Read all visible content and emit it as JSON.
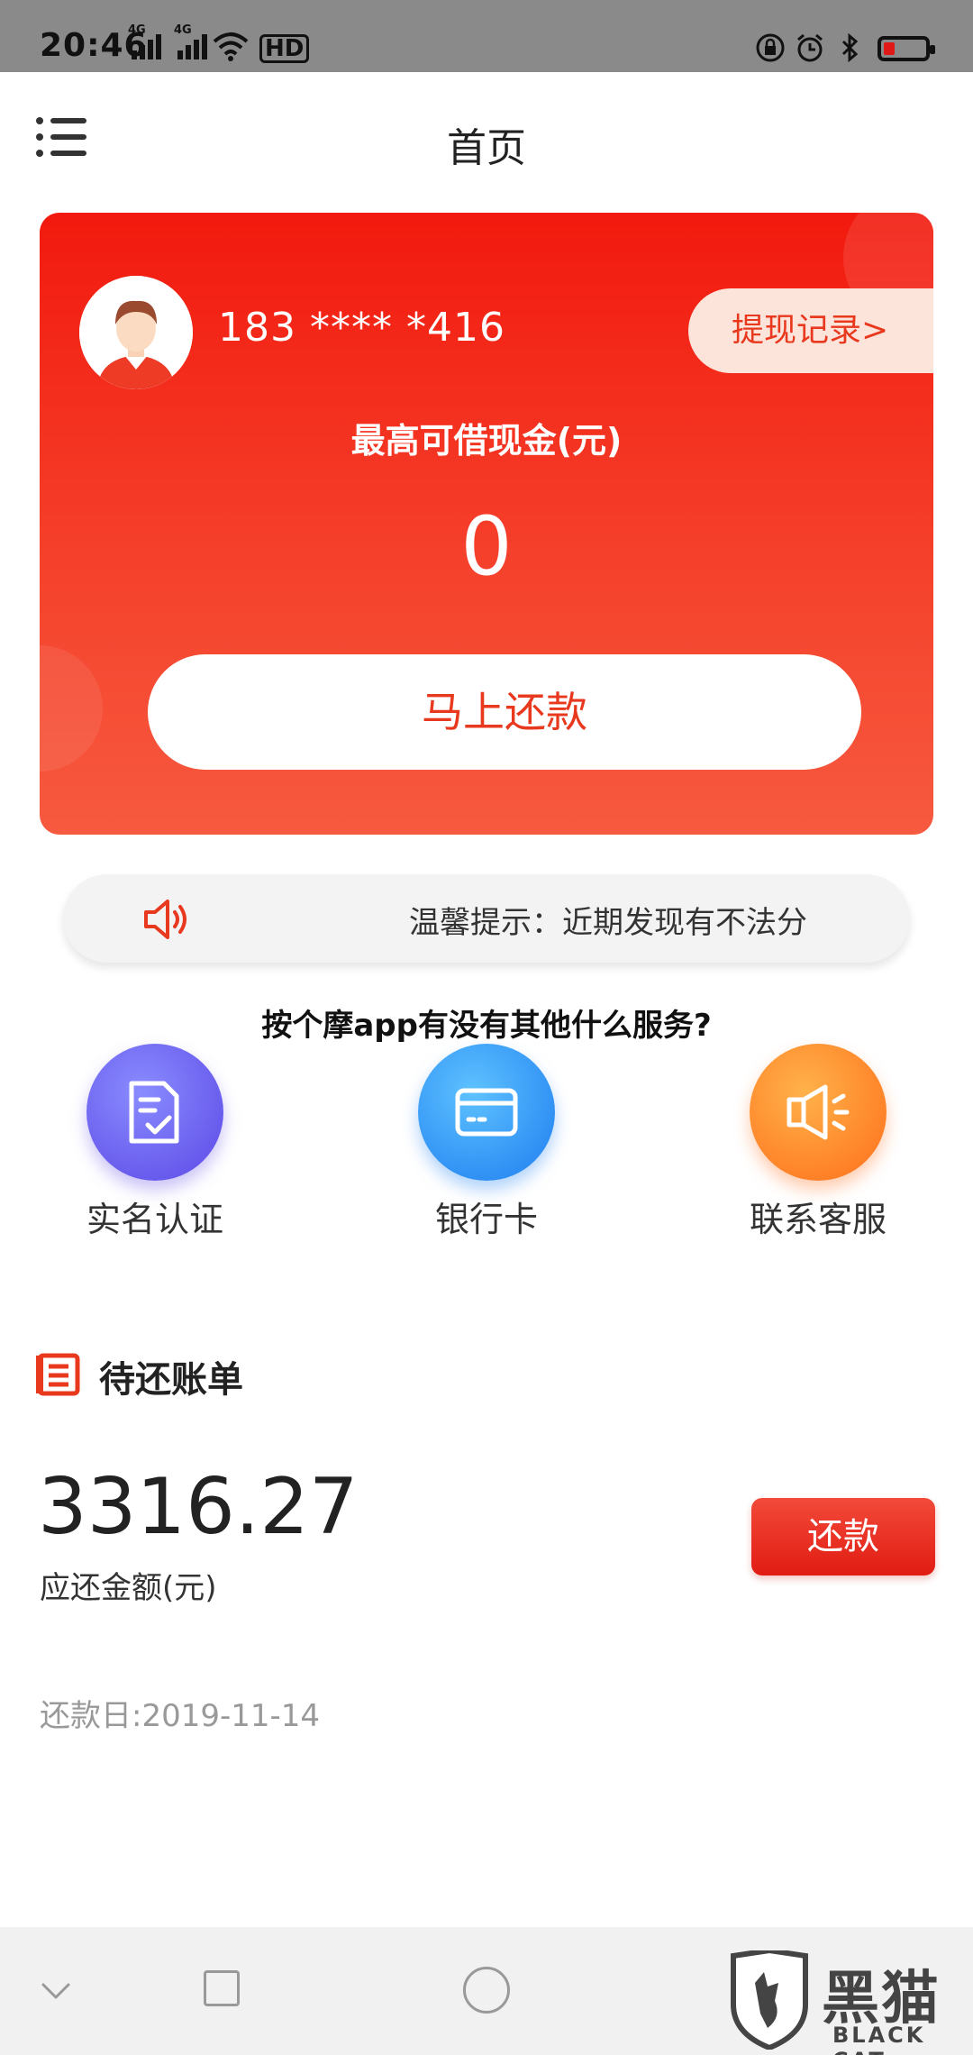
{
  "status_bar": {
    "time": "20:46",
    "network_1": "4G",
    "network_2": "4G",
    "hd_label": "HD",
    "battery_color": "#e01818"
  },
  "header": {
    "title": "首页",
    "menu_icon": "menu-icon"
  },
  "account_card": {
    "phone": "183 **** *416",
    "withdraw_records_label": "提现记录>",
    "max_loan_label": "最高可借现金(元)",
    "max_loan_value": "0",
    "repay_now_label": "马上还款",
    "accent_color": "#f2190d"
  },
  "notice": {
    "icon": "speaker-icon",
    "text": "温馨提示：近期发现有不法分"
  },
  "overlay_question": "按个摩app有没有其他什么服务?",
  "quick_actions": [
    {
      "label": "实名认证",
      "icon": "document-check-icon",
      "color": "#5b48e6"
    },
    {
      "label": "银行卡",
      "icon": "bank-card-icon",
      "color": "#1e7df0"
    },
    {
      "label": "联系客服",
      "icon": "megaphone-icon",
      "color": "#ff6e1a"
    }
  ],
  "bills": {
    "title": "待还账单",
    "icon": "bill-list-icon",
    "amount": "3316.27",
    "amount_label": "应还金额(元)",
    "repay_label": "还款",
    "due_date": "还款日:2019-11-14"
  },
  "watermark": {
    "cn": "黑猫",
    "en": "BLACK CAT"
  }
}
